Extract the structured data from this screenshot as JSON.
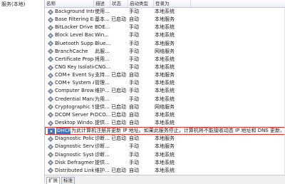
{
  "left_pane": {
    "title": "服务(本地)"
  },
  "columns": [
    "名称",
    "描述",
    "状态",
    "启动类型",
    "登录为"
  ],
  "services": [
    {
      "name": "Background Inte...",
      "desc": "使用...",
      "state": "",
      "start": "手动",
      "logon": "本地系统"
    },
    {
      "name": "Base Filtering En...",
      "desc": "基本...",
      "state": "已启动",
      "start": "自动",
      "logon": "本地服务"
    },
    {
      "name": "BitLocker Drive ...",
      "desc": "BDE...",
      "state": "",
      "start": "手动",
      "logon": "本地系统"
    },
    {
      "name": "Block Level Back...",
      "desc": "Win...",
      "state": "",
      "start": "手动",
      "logon": "本地系统"
    },
    {
      "name": "Bluetooth Supp...",
      "desc": "Blue...",
      "state": "",
      "start": "手动",
      "logon": "本地服务"
    },
    {
      "name": "BranchCache",
      "desc": "此服...",
      "state": "",
      "start": "手动",
      "logon": "网络服务"
    },
    {
      "name": "Certificate Propa...",
      "desc": "将用...",
      "state": "",
      "start": "手动",
      "logon": "本地系统"
    },
    {
      "name": "CNG Key Isolation",
      "desc": "CNG...",
      "state": "",
      "start": "手动",
      "logon": "本地系统"
    },
    {
      "name": "COM+ Event Sys...",
      "desc": "支持...",
      "state": "已启动",
      "start": "自动",
      "logon": "本地服务"
    },
    {
      "name": "COM+ System A...",
      "desc": "管理...",
      "state": "",
      "start": "手动",
      "logon": "本地系统"
    },
    {
      "name": "Computer Brow...",
      "desc": "维护...",
      "state": "已启动",
      "start": "手动",
      "logon": "本地系统"
    },
    {
      "name": "Credential Mana...",
      "desc": "为用...",
      "state": "",
      "start": "手动",
      "logon": "本地系统"
    },
    {
      "name": "Cryptographic S...",
      "desc": "提供...",
      "state": "已启动",
      "start": "自动",
      "logon": "网络服务"
    },
    {
      "name": "DCOM Server Pr...",
      "desc": "DCO...",
      "state": "已启动",
      "start": "自动",
      "logon": "本地系统"
    },
    {
      "name": "Desktop Windo...",
      "desc": "提供...",
      "state": "已启动",
      "start": "自动",
      "logon": "本地系统"
    },
    {
      "name": "DHCP Client",
      "desc": "为此计算机注册并更新 IP 地址。如果此服务停止，计算机将不能接收动态 IP 地址和 DNS 更新。",
      "state": "",
      "start": "",
      "logon": "",
      "selected": true
    },
    {
      "name": "Diagnostic Polic...",
      "desc": "诊断...",
      "state": "已启动",
      "start": "自动",
      "logon": "本地服务"
    },
    {
      "name": "Diagnostic Servi...",
      "desc": "诊断...",
      "state": "",
      "start": "手动",
      "logon": "本地服务"
    },
    {
      "name": "Diagnostic Syste...",
      "desc": "诊断...",
      "state": "",
      "start": "手动",
      "logon": "本地系统"
    },
    {
      "name": "Disk Defragmen...",
      "desc": "提供...",
      "state": "",
      "start": "手动",
      "logon": "本地系统"
    },
    {
      "name": "Distributed Link ...",
      "desc": "维护...",
      "state": "已启动",
      "start": "自动",
      "logon": "本地系统"
    }
  ],
  "tabs": [
    "扩展",
    "标准"
  ],
  "colors": {
    "selection_outline": "#e0322b",
    "selection_fill": "#3a78d6"
  },
  "icons": {
    "service": "gear-icon"
  }
}
